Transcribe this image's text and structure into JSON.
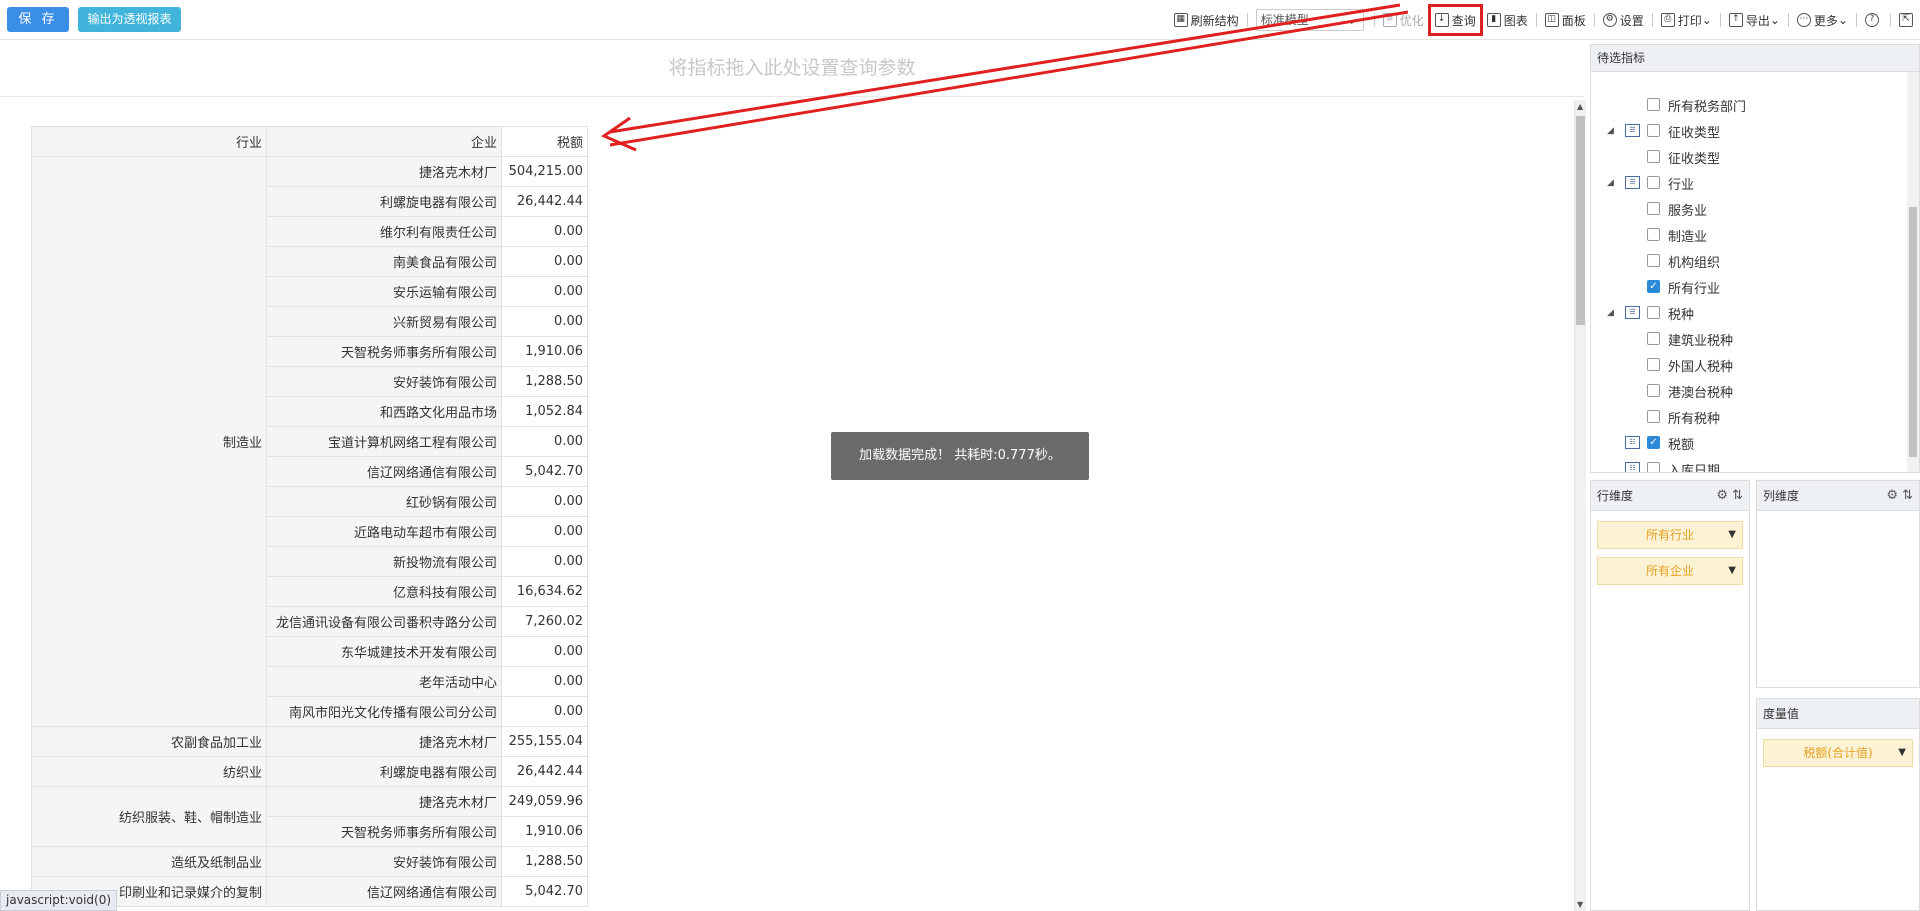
{
  "toolbar": {
    "save_label": "保 存",
    "export_pivot_label": "输出为透视报表",
    "refresh_label": "刷新结构",
    "model_value": "标准模型",
    "optimize_label": "优化",
    "query_label": "查询",
    "chart_label": "图表",
    "panel_label": "面板",
    "settings_label": "设置",
    "print_label": "打印",
    "export_label": "导出",
    "more_label": "更多",
    "help_label": "?"
  },
  "drop_area": {
    "placeholder": "将指标拖入此处设置查询参数"
  },
  "table": {
    "headers": [
      "行业",
      "企业",
      "税额"
    ],
    "groups": [
      {
        "industry": "制造业",
        "rows": [
          [
            "捷洛克木材厂",
            "504,215.00"
          ],
          [
            "利螺旋电器有限公司",
            "26,442.44"
          ],
          [
            "维尔利有限责任公司",
            "0.00"
          ],
          [
            "南美食品有限公司",
            "0.00"
          ],
          [
            "安乐运输有限公司",
            "0.00"
          ],
          [
            "兴新贸易有限公司",
            "0.00"
          ],
          [
            "天智税务师事务所有限公司",
            "1,910.06"
          ],
          [
            "安好装饰有限公司",
            "1,288.50"
          ],
          [
            "和西路文化用品市场",
            "1,052.84"
          ],
          [
            "宝道计算机网络工程有限公司",
            "0.00"
          ],
          [
            "信辽网络通信有限公司",
            "5,042.70"
          ],
          [
            "红砂锅有限公司",
            "0.00"
          ],
          [
            "近路电动车超市有限公司",
            "0.00"
          ],
          [
            "新投物流有限公司",
            "0.00"
          ],
          [
            "亿意科技有限公司",
            "16,634.62"
          ],
          [
            "龙信通讯设备有限公司番积寺路分公司",
            "7,260.02"
          ],
          [
            "东华城建技术开发有限公司",
            "0.00"
          ],
          [
            "老年活动中心",
            "0.00"
          ],
          [
            "南风市阳光文化传播有限公司分公司",
            "0.00"
          ]
        ]
      },
      {
        "industry": "农副食品加工业",
        "rows": [
          [
            "捷洛克木材厂",
            "255,155.04"
          ]
        ]
      },
      {
        "industry": "纺织业",
        "rows": [
          [
            "利螺旋电器有限公司",
            "26,442.44"
          ]
        ]
      },
      {
        "industry": "纺织服装、鞋、帽制造业",
        "rows": [
          [
            "捷洛克木材厂",
            "249,059.96"
          ],
          [
            "天智税务师事务所有限公司",
            "1,910.06"
          ]
        ]
      },
      {
        "industry": "造纸及纸制品业",
        "rows": [
          [
            "安好装饰有限公司",
            "1,288.50"
          ]
        ]
      },
      {
        "industry": "印刷业和记录媒介的复制",
        "rows": [
          [
            "信辽网络通信有限公司",
            "5,042.70"
          ]
        ]
      }
    ]
  },
  "toast": "加载数据完成！ 共耗时:0.777秒。",
  "status_link": "javascript:void(0)",
  "right_panel": {
    "title": "待选指标",
    "tree": [
      {
        "label": "所有税务部门",
        "level": 2,
        "checked": false
      },
      {
        "label": "征收类型",
        "level": 1,
        "checked": false
      },
      {
        "label": "征收类型",
        "level": 2,
        "checked": false
      },
      {
        "label": "行业",
        "level": 1,
        "checked": false
      },
      {
        "label": "服务业",
        "level": 2,
        "checked": false
      },
      {
        "label": "制造业",
        "level": 2,
        "checked": false
      },
      {
        "label": "机构组织",
        "level": 2,
        "checked": false
      },
      {
        "label": "所有行业",
        "level": 2,
        "checked": true
      },
      {
        "label": "税种",
        "level": 1,
        "checked": false
      },
      {
        "label": "建筑业税种",
        "level": 2,
        "checked": false
      },
      {
        "label": "外国人税种",
        "level": 2,
        "checked": false
      },
      {
        "label": "港澳台税种",
        "level": 2,
        "checked": false
      },
      {
        "label": "所有税种",
        "level": 2,
        "checked": false
      },
      {
        "label": "税额",
        "level": 0,
        "checked": true
      },
      {
        "label": "入库日期",
        "level": 0,
        "checked": false
      }
    ],
    "row_dim": {
      "title": "行维度",
      "items": [
        "所有行业",
        "所有企业"
      ]
    },
    "col_dim": {
      "title": "列维度"
    },
    "measure": {
      "title": "度量值",
      "items": [
        "税额(合计值)"
      ]
    }
  }
}
